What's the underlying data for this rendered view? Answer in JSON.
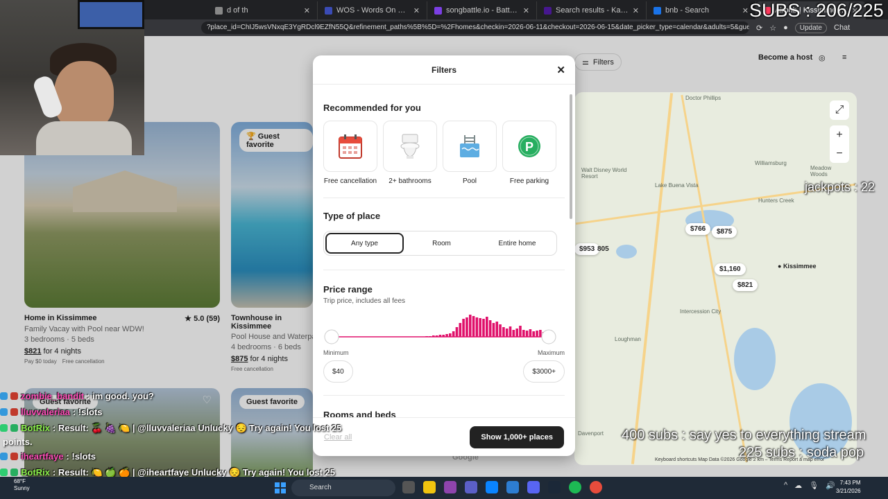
{
  "browser": {
    "tabs": [
      {
        "title": "d of th",
        "color": "#888888"
      },
      {
        "title": "WOS - Words On Stream",
        "color": "#3a4bb5"
      },
      {
        "title": "songbattle.io - Battle Songs again",
        "color": "#7b3fe4"
      },
      {
        "title": "Search results - Kahoot!",
        "color": "#46178f"
      },
      {
        "title": "bnb - Search",
        "color": "#1a73e8"
      },
      {
        "title": "Airbnb | Kissimmee - Va",
        "color": "#ff385c"
      }
    ],
    "url": "?place_id=ChIJ5wsVNxqE3YgRDcl9EZfN55Q&refinement_paths%5B%5D=%2Fhomes&checkin=2026-06-11&checkout=2026-06-15&date_picker_type=calendar&adults=5&guests=5&qu...",
    "update_label": "Update",
    "chat_label": "Chat"
  },
  "header": {
    "filters_label": "Filters",
    "host_label": "Become a host"
  },
  "listings": [
    {
      "title": "Home in Kissimmee",
      "rating": "★ 5.0 (59)",
      "desc": "Family Vacay with Pool near WDW!",
      "rooms": "3 bedrooms · 5 beds",
      "price": "$821",
      "price_suffix": " for 4 nights",
      "tags": [
        "Pay $0 today",
        "Free cancellation"
      ]
    },
    {
      "title": "Townhouse in Kissimmee",
      "badge": "Guest favorite",
      "desc": "Pool House and Waterpa",
      "rooms": "4 bedrooms · 6 beds",
      "price": "$875",
      "price_suffix": " for 4 nights",
      "tags": [
        "Free cancellation"
      ]
    }
  ],
  "lower_cards": [
    {
      "badge": "Guest favorite"
    },
    {
      "badge": "Guest favorite"
    }
  ],
  "map": {
    "pins": [
      "$766",
      "$875",
      "$953",
      "805",
      "$1,160",
      "$821"
    ],
    "label_pin": "Kissimmee",
    "towns": [
      "Doctor Phillips",
      "Williamsburg",
      "Walt Disney World Resort",
      "Lake Buena Vista",
      "Meadow Woods",
      "Hunters Creek",
      "Intercession City",
      "Loughman",
      "Davenport"
    ],
    "footer": "Keyboard shortcuts   Map Data ©2026 Google   2 km ⎯   Terms   Report a map error",
    "google": "Google"
  },
  "modal": {
    "title": "Filters",
    "recommended": {
      "heading": "Recommended for you",
      "items": [
        {
          "label": "Free cancellation",
          "icon": "calendar-icon"
        },
        {
          "label": "2+ bathrooms",
          "icon": "toilet-icon"
        },
        {
          "label": "Pool",
          "icon": "pool-icon"
        },
        {
          "label": "Free parking",
          "icon": "parking-icon"
        }
      ]
    },
    "type_of_place": {
      "heading": "Type of place",
      "options": [
        "Any type",
        "Room",
        "Entire home"
      ],
      "selected": "Any type"
    },
    "price": {
      "heading": "Price range",
      "subheading": "Trip price, includes all fees",
      "min_label": "Minimum",
      "max_label": "Maximum",
      "min_value": "$40",
      "max_value": "$3000+",
      "histogram": [
        0,
        0,
        0,
        0,
        0,
        0,
        0,
        0,
        0,
        0,
        0,
        0,
        0,
        0,
        0,
        0,
        0,
        0,
        0,
        0,
        0,
        0,
        0,
        0,
        0,
        0,
        0,
        0,
        1,
        1,
        2,
        2,
        3,
        3,
        4,
        5,
        8,
        14,
        20,
        26,
        28,
        32,
        30,
        28,
        27,
        26,
        29,
        24,
        20,
        22,
        18,
        14,
        12,
        15,
        10,
        12,
        16,
        10,
        9,
        11,
        8,
        9,
        10,
        7,
        6
      ],
      "accent": "#e0116b"
    },
    "rooms_heading": "Rooms and beds",
    "clear_label": "Clear all",
    "show_label": "Show 1,000+ places"
  },
  "overlay": {
    "subs": "SUBS : 206/225",
    "jackpots": "jackpots : 22",
    "goal_400": "400 subs :  say yes to everything stream",
    "goal_225": "225 subs : soda pop",
    "chat": [
      {
        "user": "zombie_bandit",
        "text": ": im good. you?",
        "bot": false
      },
      {
        "user": "lluvvaleriaa",
        "text": ": !slots",
        "bot": false
      },
      {
        "user": "BotRix",
        "text": ": Result: 🍒 🍇 🍋 | @lluvvaleriaa Unlucky 😔 Try again! You lost 25",
        "bot": true
      },
      {
        "user": "",
        "text": "points.",
        "bot": false,
        "wrap": true
      },
      {
        "user": "iheartfaye",
        "text": ": !slots",
        "bot": false
      },
      {
        "user": "BotRix",
        "text": ": Result: 🍋 🍏 🍊 | @iheartfaye Unlucky 😔 Try again! You lost 25",
        "bot": true
      },
      {
        "user": "",
        "text": "points.",
        "bot": false,
        "wrap": true
      }
    ]
  },
  "taskbar": {
    "temp": "68°F",
    "weather": "Sunny",
    "search": "Search",
    "time": "7:43 PM",
    "date": "3/21/2026"
  }
}
